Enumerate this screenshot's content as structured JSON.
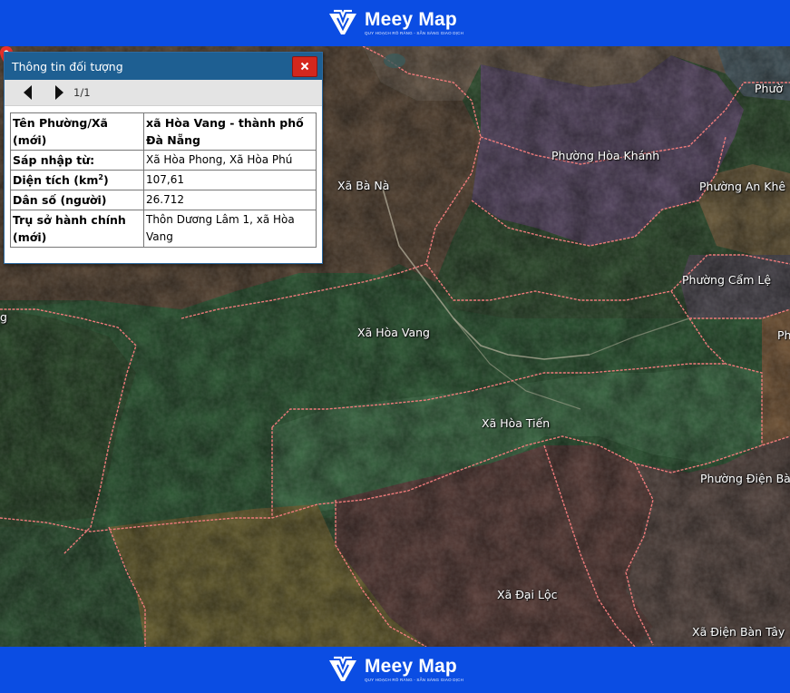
{
  "brand": {
    "name": "Meey Map",
    "tagline": "QUY HOẠCH RÕ RÀNG - SẴN SÀNG GIAO DỊCH",
    "colors": {
      "bar": "#0b4de3",
      "logo": "#ffffff"
    }
  },
  "info_panel": {
    "title": "Thông tin đối tượng",
    "close_icon": "close-x-icon",
    "pager": "1/1",
    "rows": [
      {
        "key": "Tên Phường/Xã (mới)",
        "value": "xã Hòa Vang - thành phố Đà Nẵng"
      },
      {
        "key": "Sáp nhập từ:",
        "value": "Xã Hòa Phong, Xã Hòa Phú"
      },
      {
        "key_prefix": "Diện tích (km",
        "key_sup": "2",
        "key_suffix": ")",
        "value": "107,61"
      },
      {
        "key": "Dân số (người)",
        "value": "26.712"
      },
      {
        "key": "Trụ sở hành chính (mới)",
        "value": "Thôn Dương Lâm 1, xã Hòa Vang"
      }
    ]
  },
  "map": {
    "type": "satellite",
    "boundary_color": "#ef7b7b",
    "selected_marker": "map-pin-icon",
    "labels": [
      "Xã Bà Nà",
      "Phường Hòa Khánh",
      "Phường An Khê",
      "Phường Cẩm Lệ",
      "Xã Hòa Vang",
      "Xã Hòa Tiến",
      "Phường Điện Bà",
      "Xã Đại Lộc",
      "Xã Điện Bàn Tây",
      "Phườ",
      "Ph",
      "g"
    ]
  }
}
